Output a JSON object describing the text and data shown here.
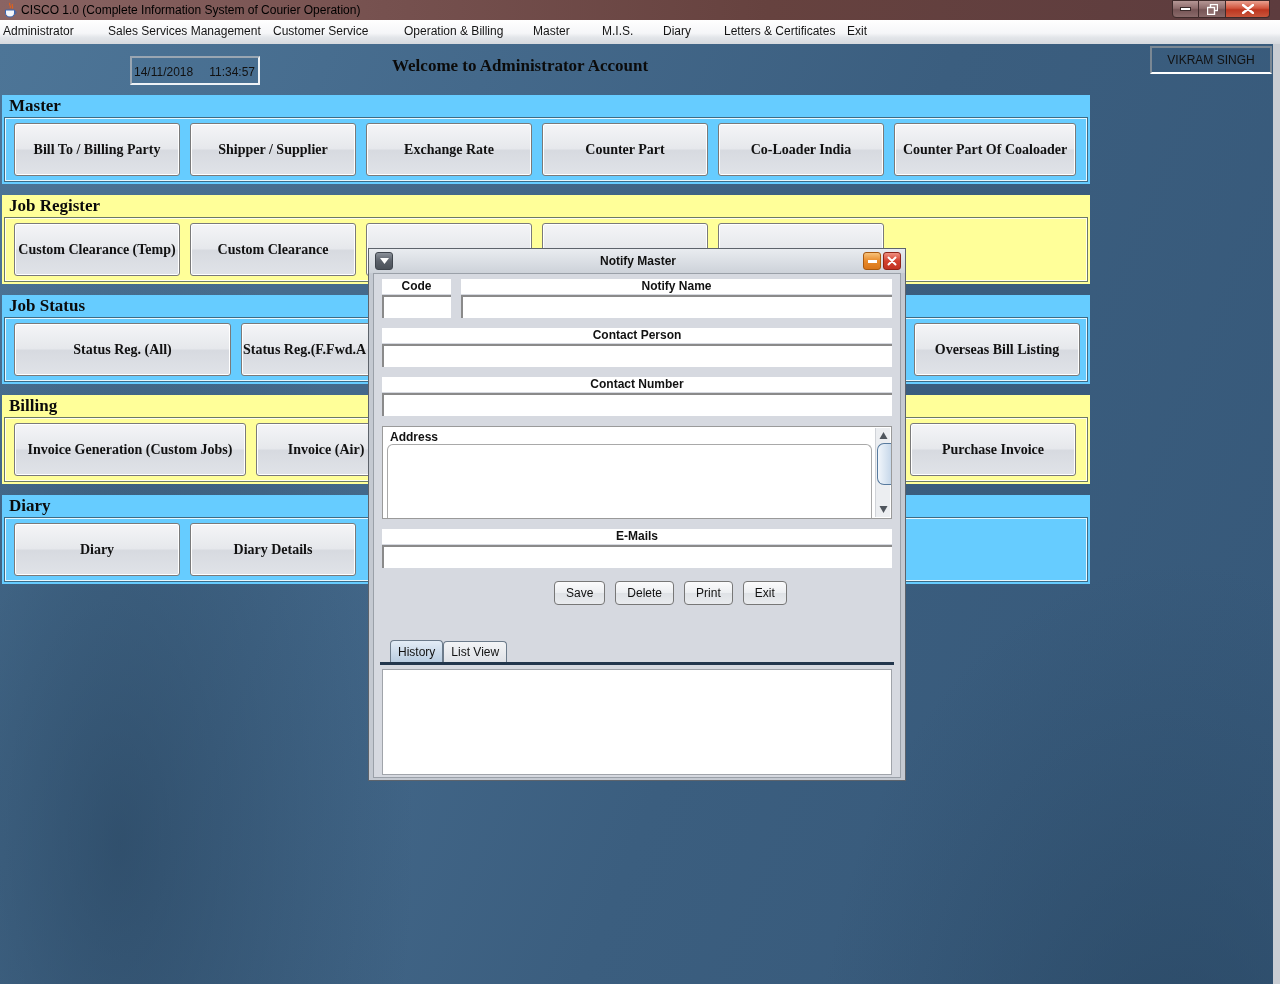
{
  "window": {
    "title": "CISCO 1.0 (Complete Information System of Courier Operation)"
  },
  "menu": [
    "Administrator",
    "Sales Services Management",
    "Customer Service",
    "Operation & Billing",
    "Master",
    "M.I.S.",
    "Diary",
    "Letters & Certificates",
    "Exit"
  ],
  "header": {
    "date": "14/11/2018",
    "time": "11:34:57",
    "welcome": "Welcome to Administrator Account",
    "user": "VIKRAM SINGH"
  },
  "sections": [
    {
      "title": "Master",
      "color": "#66ccff",
      "buttons": [
        {
          "kind": "labeled",
          "label": "Bill To / Billing Party"
        },
        {
          "kind": "labeled",
          "label": "Shipper / Supplier"
        },
        {
          "kind": "labeled",
          "label": "Exchange Rate"
        },
        {
          "kind": "labeled",
          "label": "Counter Part"
        },
        {
          "kind": "labeled",
          "label": "Co-Loader India"
        },
        {
          "kind": "labeled",
          "label": "Counter Part Of Coaloader"
        }
      ]
    },
    {
      "title": "Job Register",
      "color": "#ffff99",
      "buttons": [
        {
          "kind": "labeled",
          "label": "Custom Clearance (Temp)"
        },
        {
          "kind": "labeled",
          "label": "Custom Clearance"
        },
        {
          "kind": "covered"
        },
        {
          "kind": "covered"
        },
        {
          "kind": "covered"
        }
      ]
    },
    {
      "title": "Job Status",
      "color": "#66ccff",
      "buttons": [
        {
          "kind": "labeled",
          "label": "Status Reg. (All)"
        },
        {
          "kind": "labeled",
          "label": "Status Reg.(F.Fwd.A"
        },
        {
          "kind": "labeled",
          "label": "Overseas Bill Listing"
        }
      ]
    },
    {
      "title": "Billing",
      "color": "#ffff99",
      "buttons": [
        {
          "kind": "labeled",
          "label": "Invoice Generation (Custom Jobs)"
        },
        {
          "kind": "labeled",
          "label": "Invoice (Air)"
        },
        {
          "kind": "labeled",
          "label": "Purchase Invoice"
        }
      ]
    },
    {
      "title": "Diary",
      "color": "#66ccff",
      "buttons": [
        {
          "kind": "labeled",
          "label": "Diary"
        },
        {
          "kind": "labeled",
          "label": "Diary Details"
        }
      ]
    }
  ],
  "dialog": {
    "title": "Notify Master",
    "field_rows": [
      [
        {
          "label": "Code",
          "kind": "text"
        },
        {
          "label": "Notify Name",
          "kind": "text"
        }
      ],
      [
        {
          "label": "Contact Person",
          "kind": "text"
        }
      ],
      [
        {
          "label": "Contact Number",
          "kind": "text"
        }
      ],
      [
        {
          "label": "Address",
          "kind": "textarea"
        }
      ],
      [
        {
          "label": "E-Mails",
          "kind": "text"
        }
      ]
    ],
    "buttons": [
      "Save",
      "Delete",
      "Print",
      "Exit"
    ],
    "tabs": [
      {
        "label": "History",
        "selected": true
      },
      {
        "label": "List View",
        "selected": false
      }
    ]
  }
}
